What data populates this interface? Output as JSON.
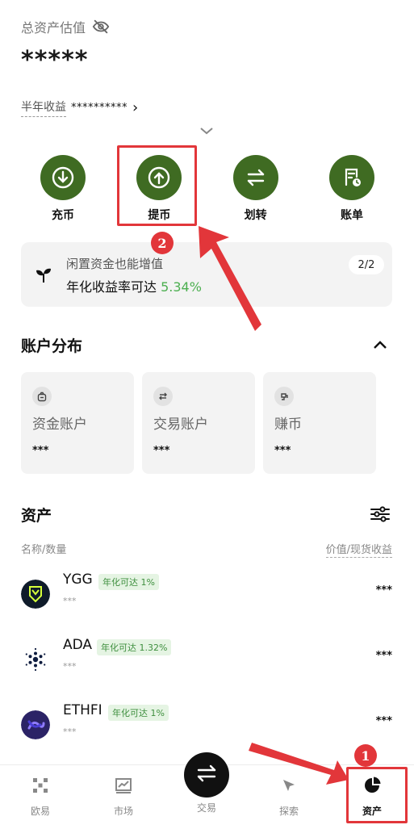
{
  "header": {
    "est_label": "总资产估值",
    "balance_masked": "*****",
    "half_year_label": "半年收益",
    "half_year_value": "**********"
  },
  "actions": [
    {
      "label": "充币",
      "icon": "deposit-icon"
    },
    {
      "label": "提币",
      "icon": "withdraw-icon"
    },
    {
      "label": "划转",
      "icon": "transfer-icon"
    },
    {
      "label": "账单",
      "icon": "bill-icon"
    }
  ],
  "promo": {
    "line1": "闲置资金也能增值",
    "line2_prefix": "年化收益率可达 ",
    "rate": "5.34%",
    "page": "2/2"
  },
  "account_section": {
    "title": "账户分布",
    "cards": [
      {
        "name": "资金账户",
        "value": "***",
        "icon": "wallet-icon"
      },
      {
        "name": "交易账户",
        "value": "***",
        "icon": "exchange-icon"
      },
      {
        "name": "赚币",
        "value": "***",
        "icon": "earn-icon"
      }
    ]
  },
  "assets_section": {
    "title": "资产",
    "col_left": "名称/数量",
    "col_right": "价值/现货收益",
    "items": [
      {
        "symbol": "YGG",
        "tag": "年化可达 1%",
        "amount": "***",
        "value": "***"
      },
      {
        "symbol": "ADA",
        "tag": "年化可达 1.32%",
        "amount": "***",
        "value": "***"
      },
      {
        "symbol": "ETHFI",
        "tag": "年化可达 1%",
        "amount": "***",
        "value": "***"
      }
    ]
  },
  "tabbar": {
    "tabs": [
      {
        "label": "欧易",
        "icon": "okx-logo-icon"
      },
      {
        "label": "市场",
        "icon": "chart-icon"
      },
      {
        "label": "交易",
        "icon": "swap-icon"
      },
      {
        "label": "探索",
        "icon": "compass-icon"
      },
      {
        "label": "资产",
        "icon": "pie-chart-icon"
      }
    ]
  },
  "annotations": {
    "marker1": "1",
    "marker2": "2",
    "color": "#e2363a"
  },
  "colors": {
    "accent_green": "#3f6b22",
    "rate_green": "#4caf50"
  }
}
